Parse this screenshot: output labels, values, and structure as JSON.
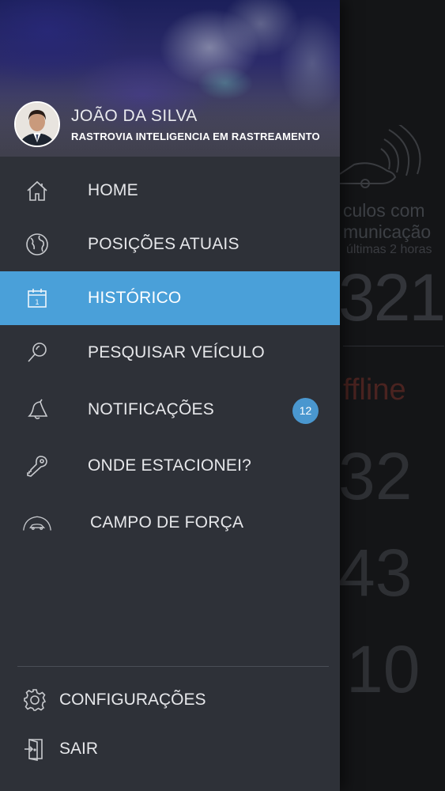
{
  "user": {
    "name": "JOÃO DA SILVA",
    "company": "RASTROVIA INTELIGENCIA EM RASTREAMENTO"
  },
  "menu": {
    "items": [
      {
        "label": "HOME",
        "icon": "home-icon"
      },
      {
        "label": "POSIÇÕES ATUAIS",
        "icon": "globe-icon"
      },
      {
        "label": "HISTÓRICO",
        "icon": "calendar-icon",
        "active": true
      },
      {
        "label": "PESQUISAR VEÍCULO",
        "icon": "search-icon"
      },
      {
        "label": "NOTIFICAÇÕES",
        "icon": "bell-icon",
        "badge": "12"
      },
      {
        "label": "ONDE ESTACIONEI?",
        "icon": "key-icon"
      },
      {
        "label": "CAMPO DE FORÇA",
        "icon": "force-field-icon"
      }
    ]
  },
  "footer": {
    "settings_label": "CONFIGURAÇÕES",
    "logout_label": "SAIR"
  },
  "background": {
    "line1": "culos com",
    "line2": "municação",
    "line3": "últimas 2 horas",
    "count_online": "321",
    "offline_label": "ffline",
    "count_2": "32",
    "count_3": "43",
    "count_4": "10"
  },
  "colors": {
    "drawer": "#2e3138",
    "active": "#4aa0d9",
    "badge": "#4a97cf",
    "offline": "#4a2320"
  }
}
